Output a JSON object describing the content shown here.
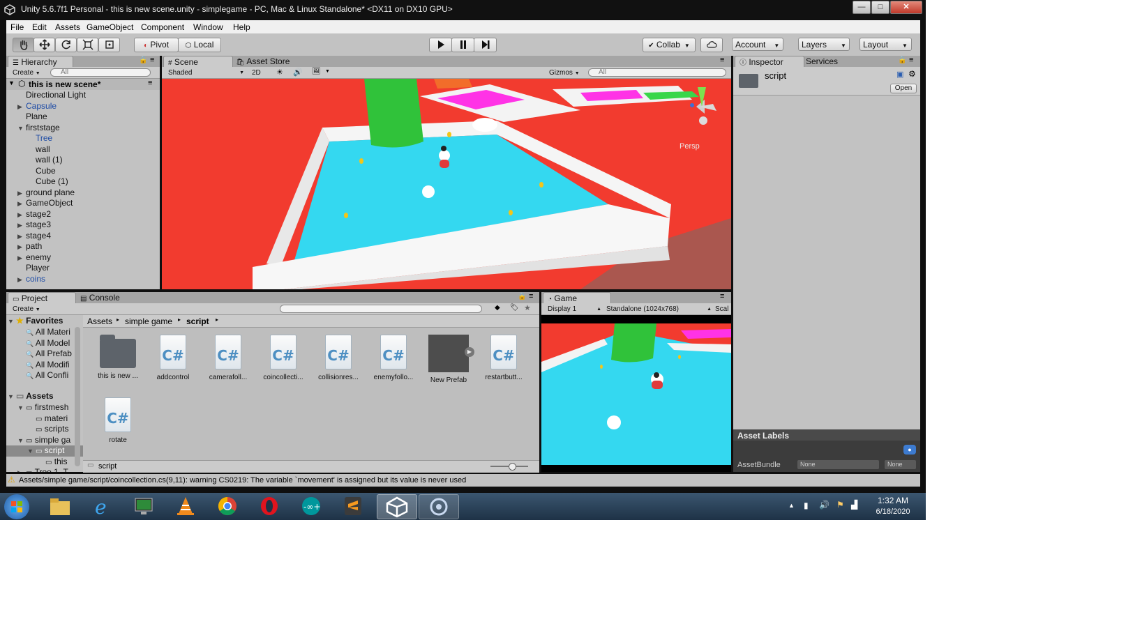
{
  "window": {
    "title": "Unity 5.6.7f1 Personal - this is new scene.unity - simplegame - PC, Mac & Linux Standalone* <DX11 on DX10 GPU>",
    "controls": [
      "—",
      "□",
      "✕"
    ]
  },
  "menu": [
    "File",
    "Edit",
    "Assets",
    "GameObject",
    "Component",
    "Window",
    "Help"
  ],
  "toolbar": {
    "pivot": "Pivot",
    "local": "Local",
    "collab": "Collab",
    "account": "Account",
    "layers": "Layers",
    "layout": "Layout"
  },
  "hierarchy": {
    "tab": "Hierarchy",
    "create": "Create",
    "search_placeholder": "All",
    "scene_name": "this is new scene*",
    "items": [
      {
        "label": "Directional Light",
        "indent": 0,
        "arrow": "",
        "color": "black"
      },
      {
        "label": "Capsule",
        "indent": 0,
        "arrow": "right",
        "color": "blue"
      },
      {
        "label": "Plane",
        "indent": 0,
        "arrow": "",
        "color": "black"
      },
      {
        "label": "firststage",
        "indent": 0,
        "arrow": "down",
        "color": "black"
      },
      {
        "label": "Tree",
        "indent": 1,
        "arrow": "",
        "color": "blue"
      },
      {
        "label": "wall",
        "indent": 1,
        "arrow": "",
        "color": "black"
      },
      {
        "label": "wall (1)",
        "indent": 1,
        "arrow": "",
        "color": "black"
      },
      {
        "label": "Cube",
        "indent": 1,
        "arrow": "",
        "color": "black"
      },
      {
        "label": "Cube (1)",
        "indent": 1,
        "arrow": "",
        "color": "black"
      },
      {
        "label": "ground plane",
        "indent": 0,
        "arrow": "right",
        "color": "black"
      },
      {
        "label": "GameObject",
        "indent": 0,
        "arrow": "right",
        "color": "black"
      },
      {
        "label": "stage2",
        "indent": 0,
        "arrow": "right",
        "color": "black"
      },
      {
        "label": "stage3",
        "indent": 0,
        "arrow": "right",
        "color": "black"
      },
      {
        "label": "stage4",
        "indent": 0,
        "arrow": "right",
        "color": "black"
      },
      {
        "label": "path",
        "indent": 0,
        "arrow": "right",
        "color": "black"
      },
      {
        "label": "enemy",
        "indent": 0,
        "arrow": "right",
        "color": "black"
      },
      {
        "label": "Player",
        "indent": 0,
        "arrow": "",
        "color": "black"
      },
      {
        "label": "coins",
        "indent": 0,
        "arrow": "right",
        "color": "blue"
      }
    ]
  },
  "scene": {
    "tab": "Scene",
    "asset_store_tab": "Asset Store",
    "shading": "Shaded",
    "mode_2d": "2D",
    "gizmos": "Gizmos",
    "search_placeholder": "All",
    "persp": "Persp"
  },
  "inspector": {
    "tab": "Inspector",
    "services_tab": "Services",
    "selected_name": "script",
    "open_button": "Open",
    "asset_labels": "Asset Labels",
    "asset_bundle_label": "AssetBundle",
    "bundle_value": "None",
    "variant_value": "None"
  },
  "project": {
    "tab": "Project",
    "console_tab": "Console",
    "create": "Create",
    "favorites_label": "Favorites",
    "favorites": [
      "All Materi",
      "All Model",
      "All Prefab",
      "All Modifi",
      "All Confli"
    ],
    "assets_label": "Assets",
    "tree": [
      {
        "label": "firstmesh",
        "indent": 1,
        "arrow": "down"
      },
      {
        "label": "materi",
        "indent": 2,
        "arrow": ""
      },
      {
        "label": "scripts",
        "indent": 2,
        "arrow": ""
      },
      {
        "label": "simple ga",
        "indent": 1,
        "arrow": "down"
      },
      {
        "label": "script",
        "indent": 2,
        "arrow": "down",
        "selected": true
      },
      {
        "label": "this",
        "indent": 3,
        "arrow": ""
      },
      {
        "label": "Tree 1_T",
        "indent": 1,
        "arrow": "right"
      }
    ],
    "breadcrumb": [
      "Assets",
      "simple game",
      "script"
    ],
    "items": [
      {
        "label": "this is new ...",
        "kind": "folder"
      },
      {
        "label": "addcontrol",
        "kind": "cs"
      },
      {
        "label": "camerafoll...",
        "kind": "cs"
      },
      {
        "label": "coincollecti...",
        "kind": "cs"
      },
      {
        "label": "collisionres...",
        "kind": "cs"
      },
      {
        "label": "enemyfollo...",
        "kind": "cs"
      },
      {
        "label": "New Prefab",
        "kind": "prefab"
      },
      {
        "label": "restartbutt...",
        "kind": "cs"
      },
      {
        "label": "rotate",
        "kind": "cs"
      }
    ],
    "footer_path": "script"
  },
  "game": {
    "tab": "Game",
    "display": "Display 1",
    "resolution": "Standalone (1024x768)",
    "scale": "Scal"
  },
  "status_bar": "Assets/simple game/script/coincollection.cs(9,11): warning CS0219: The variable `movement' is assigned but its value is never used",
  "taskbar": {
    "apps": [
      "explorer",
      "internet-explorer",
      "terminal",
      "vlc",
      "chrome",
      "opera",
      "arduino",
      "sublime-text",
      "unity",
      "unity-hub"
    ],
    "time": "1:32 AM",
    "date": "6/18/2020"
  },
  "colors": {
    "ground": "#f23b2f",
    "floor": "#34d8f0",
    "wall": "#f3f3f3",
    "tree": "#30c23a",
    "panel": "#c2c2c2"
  }
}
